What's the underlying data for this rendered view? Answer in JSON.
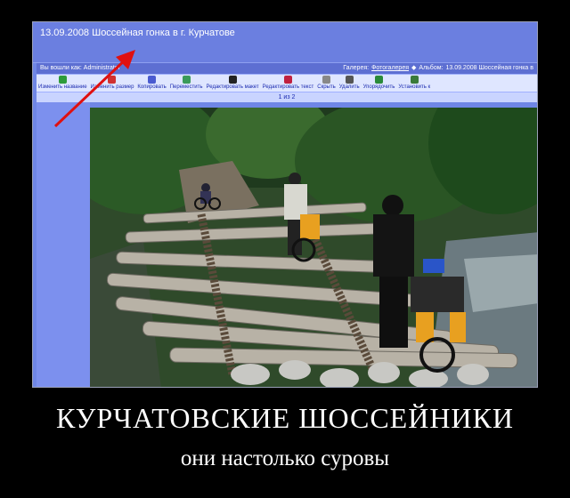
{
  "page": {
    "title": "13.09.2008 Шоссейная гонка в г. Курчатове"
  },
  "infobar": {
    "logged_in": "Вы вошли как: Administrator",
    "gallery_label": "Галерея:",
    "gallery_name": "Фотогалерея",
    "album_label": "Альбом:",
    "album_name": "13.09.2008 Шоссейная гонка в"
  },
  "toolbar": {
    "items": [
      {
        "label": "Изменить название",
        "icon": "edit-icon",
        "color": "#2e9b3a"
      },
      {
        "label": "Изменить размер",
        "icon": "resize-icon",
        "color": "#d03030"
      },
      {
        "label": "Копировать",
        "icon": "copy-icon",
        "color": "#4a5bd0"
      },
      {
        "label": "Переместить",
        "icon": "move-icon",
        "color": "#3a9a5a"
      },
      {
        "label": "Редактировать макет",
        "icon": "layout-icon",
        "color": "#222"
      },
      {
        "label": "Редактировать текст",
        "icon": "text-icon",
        "color": "#c02040"
      },
      {
        "label": "Скрыть",
        "icon": "hide-icon",
        "color": "#888"
      },
      {
        "label": "Удалить",
        "icon": "trash-icon",
        "color": "#555"
      },
      {
        "label": "Упорядочить",
        "icon": "sort-icon",
        "color": "#2a8a3a"
      },
      {
        "label": "Установить к",
        "icon": "set-icon",
        "color": "#3a7a3a"
      }
    ]
  },
  "pager": {
    "text": "1 из 2"
  },
  "caption": {
    "title": "КУРЧАТОВСКИЕ ШОССЕЙНИКИ",
    "subtitle": "они настолько суровы"
  },
  "colors": {
    "frame_blue": "#6f86e6",
    "arrow_red": "#e01010"
  }
}
